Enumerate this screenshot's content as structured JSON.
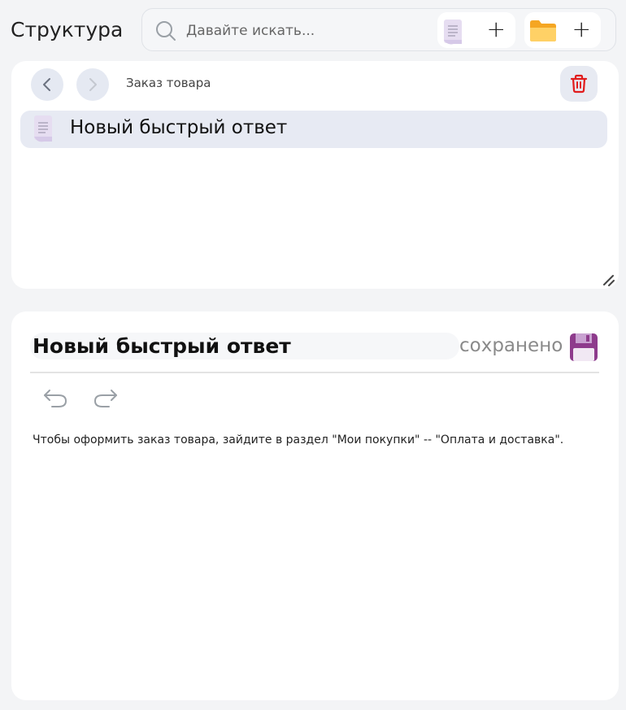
{
  "header": {
    "title": "Структура",
    "search": {
      "placeholder": "Давайте искать...",
      "value": ""
    },
    "add_document_plus": "+",
    "add_folder_plus": "+"
  },
  "structure_panel": {
    "breadcrumb": "Заказ товара",
    "items": [
      {
        "label": "Новый быстрый ответ",
        "icon": "document-icon",
        "selected": true
      }
    ]
  },
  "editor": {
    "title": "Новый быстрый ответ",
    "status": "сохранено",
    "content": "Чтобы оформить заказ товара, зайдите в раздел \"Мои покупки\" -- \"Оплата и доставка\"."
  },
  "colors": {
    "background": "#f3f4f6",
    "panel": "#ffffff",
    "selected_row": "#e7eaf3",
    "trash_red": "#e11d1d",
    "save_purple": "#8e3b8c",
    "folder_yellow": "#f7b731"
  }
}
